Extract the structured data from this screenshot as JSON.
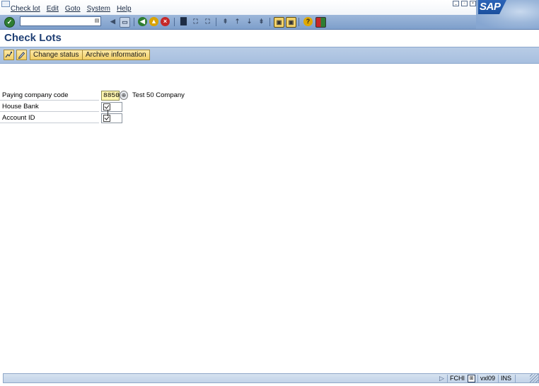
{
  "menu": {
    "items": [
      "Check lot",
      "Edit",
      "Goto",
      "System",
      "Help"
    ]
  },
  "system_toolbar": {
    "command_field_value": "",
    "icons": [
      "enter-icon",
      "back-icon",
      "exit-icon",
      "cancel-icon",
      "print-icon",
      "find-icon",
      "find-next-icon",
      "first-page-icon",
      "previous-page-icon",
      "next-page-icon",
      "last-page-icon",
      "new-session-icon",
      "shortcut-icon",
      "help-icon",
      "layout-icon"
    ]
  },
  "brand": {
    "logo_text": "SAP"
  },
  "page": {
    "title": "Check Lots"
  },
  "app_toolbar": {
    "display_icon": "display-icon",
    "change_icon": "change-icon",
    "change_status_label": "Change status",
    "archive_information_label": "Archive information"
  },
  "form": {
    "paying_company_code": {
      "label": "Paying company code",
      "value": "8850",
      "description": "Test 50 Company"
    },
    "house_bank": {
      "label": "House Bank",
      "value": ""
    },
    "account_id": {
      "label": "Account ID",
      "value": ""
    }
  },
  "status_bar": {
    "system": "FCHI",
    "client_server": "vxl09",
    "mode": "INS"
  },
  "colors": {
    "toolbar_blue": "#8aa8d3",
    "required_field": "#fff6b0",
    "button_yellow": "#f2cf66",
    "title_blue": "#1f3f74"
  }
}
